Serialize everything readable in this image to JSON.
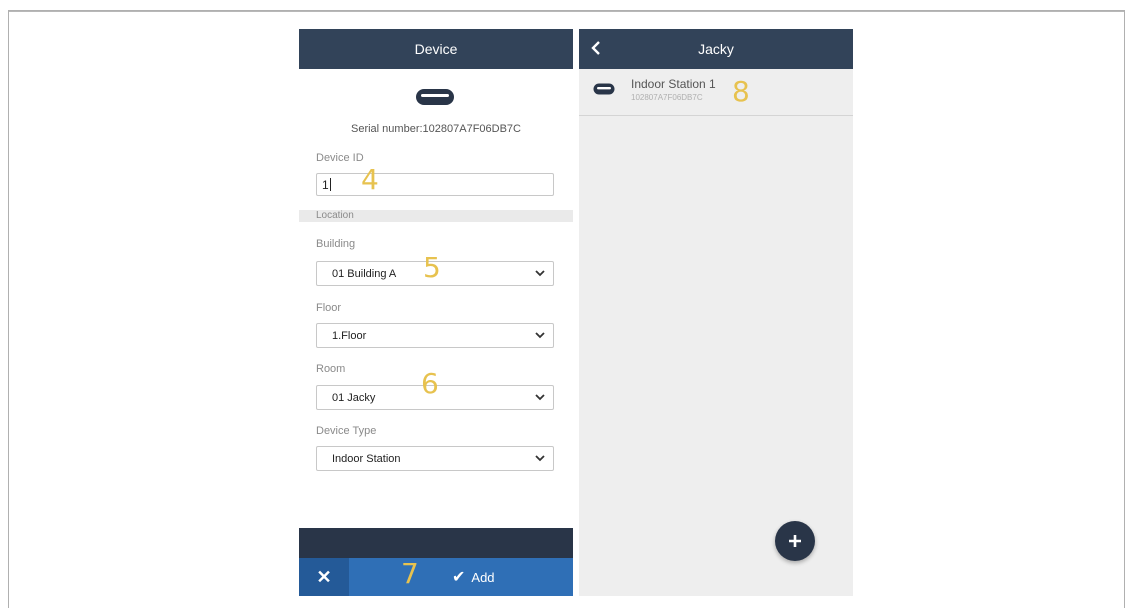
{
  "left_panel": {
    "title": "Device",
    "icon": "device-icon",
    "serial_text": "Serial number:102807A7F06DB7C",
    "device_id": {
      "label": "Device ID",
      "value": "1"
    },
    "section_label": "Location",
    "building": {
      "label": "Building",
      "value": "01 Building A"
    },
    "floor": {
      "label": "Floor",
      "value": "1.Floor"
    },
    "room": {
      "label": "Room",
      "value": "01 Jacky"
    },
    "device_type": {
      "label": "Device Type",
      "value": "Indoor Station"
    },
    "footer": {
      "cancel_icon": "close-icon",
      "add_label": "Add",
      "add_icon": "check-icon"
    }
  },
  "right_panel": {
    "title": "Jacky",
    "back_icon": "chevron-left-icon",
    "items": [
      {
        "title": "Indoor Station 1",
        "serial": "102807A7F06DB7C",
        "icon": "device-icon"
      }
    ],
    "fab_icon": "plus-icon"
  },
  "callouts": [
    "4",
    "5",
    "6",
    "7",
    "8"
  ],
  "colors": {
    "header": "#324359",
    "footer_blue": "#2f6fb6",
    "cancel_blue": "#245a98",
    "callout": "#e7c24f",
    "right_bg": "#eeeeee"
  }
}
